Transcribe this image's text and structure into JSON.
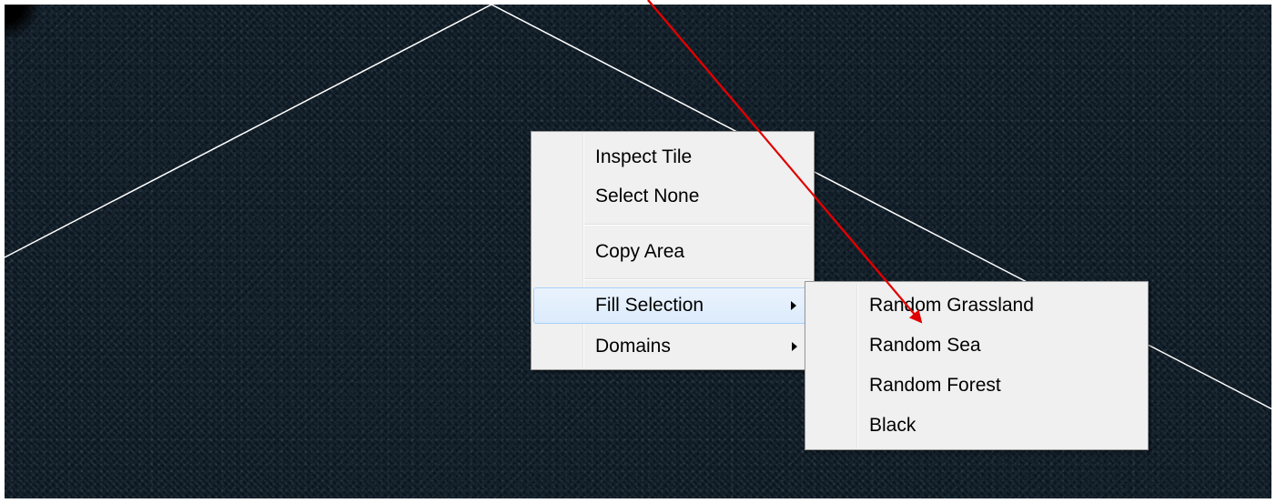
{
  "context_menu": {
    "items": [
      {
        "label": "Inspect Tile",
        "has_submenu": false
      },
      {
        "label": "Select None",
        "has_submenu": false
      },
      {
        "label": "Copy Area",
        "has_submenu": false
      },
      {
        "label": "Fill Selection",
        "has_submenu": true,
        "highlighted": true
      },
      {
        "label": "Domains",
        "has_submenu": true
      }
    ]
  },
  "submenu": {
    "items": [
      {
        "label": "Random Grassland"
      },
      {
        "label": "Random Sea"
      },
      {
        "label": "Random Forest"
      },
      {
        "label": "Black"
      }
    ]
  },
  "colors": {
    "map_background": "#0b1620",
    "grid_line": "#ffffff",
    "annotation_arrow": "#e00000",
    "menu_background": "#f0f0f0",
    "menu_highlight": "#dcebfc",
    "menu_highlight_border": "#a8d2f8"
  },
  "icons": {
    "submenu_arrow": "chevron-right-icon",
    "annotation": "red-arrow-icon"
  }
}
